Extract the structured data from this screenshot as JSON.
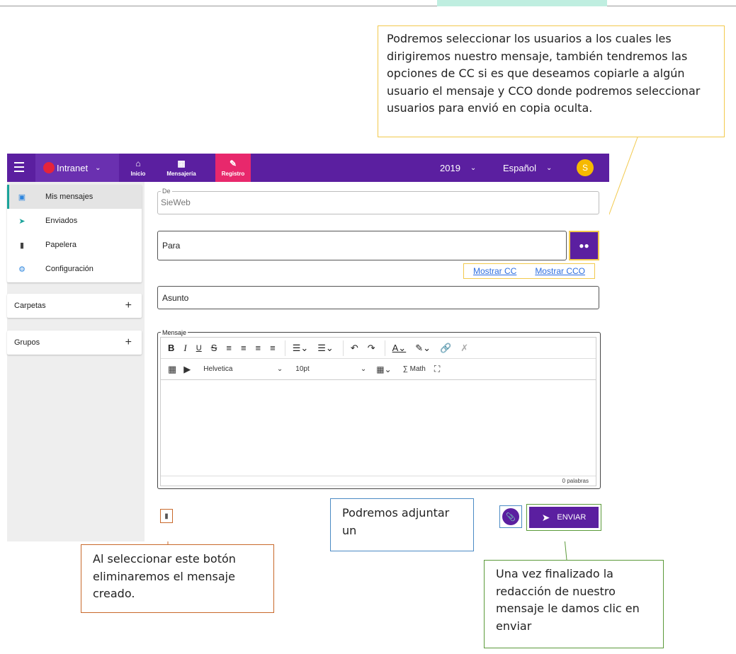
{
  "callouts": {
    "recipients": "Podremos seleccionar los usuarios a los cuales les dirigiremos nuestro mensaje, también tendremos las opciones de CC si es que deseamos copiarle a algún usuario el mensaje y CCO donde podremos seleccionar usuarios para envió en copia oculta.",
    "delete": "Al seleccionar este botón eliminaremos el mensaje creado.",
    "attach": "Podremos adjuntar un",
    "send": "Una vez finalizado la redacción de nuestro mensaje le damos clic en enviar"
  },
  "topbar": {
    "app_name": "Intranet",
    "nav": [
      {
        "label": "Inicio",
        "icon": "home-icon"
      },
      {
        "label": "Mensajería",
        "icon": "inbox-icon"
      },
      {
        "label": "Registro",
        "icon": "edit-icon"
      }
    ],
    "year": "2019",
    "language": "Español",
    "avatar_initial": "S",
    "colors": {
      "bar": "#5b1fa0",
      "active_tab": "#e8286c",
      "avatar": "#f6b900"
    }
  },
  "sidebar": {
    "items": [
      {
        "label": "Mis mensajes",
        "icon": "inbox-icon"
      },
      {
        "label": "Enviados",
        "icon": "send-icon"
      },
      {
        "label": "Papelera",
        "icon": "trash-icon"
      },
      {
        "label": "Configuración",
        "icon": "gear-icon"
      }
    ],
    "folders_label": "Carpetas",
    "groups_label": "Grupos",
    "add_symbol": "+"
  },
  "form": {
    "from_legend": "De",
    "from_value": "SieWeb",
    "to_placeholder": "Para",
    "show_cc": "Mostrar CC",
    "show_cco": "Mostrar CCO",
    "subject_placeholder": "Asunto",
    "message_legend": "Mensaje",
    "font_family": "Helvetica",
    "font_size": "10pt",
    "math_label": "Math",
    "word_count": "0 palabras",
    "send_label": "ENVIAR"
  }
}
